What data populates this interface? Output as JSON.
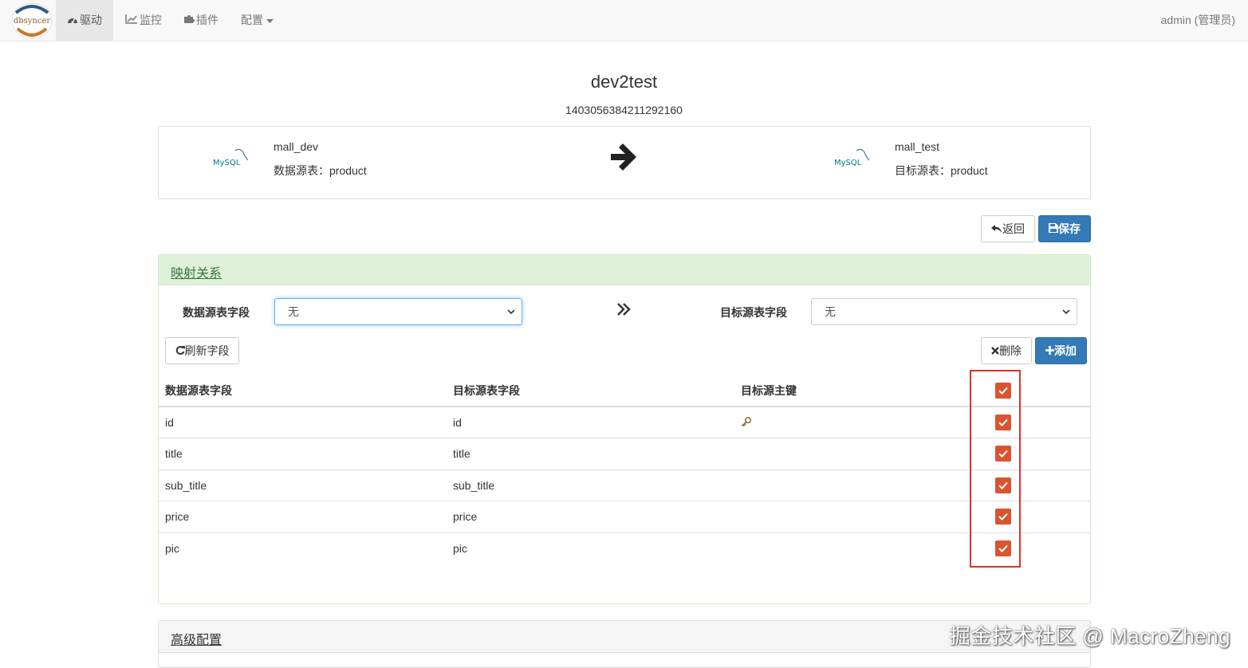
{
  "nav": {
    "brand": "dbsyncer",
    "items": [
      {
        "label": "驱动",
        "icon": "dashboard-icon",
        "active": true
      },
      {
        "label": "监控",
        "icon": "line-chart-icon",
        "active": false
      },
      {
        "label": "插件",
        "icon": "puzzle-icon",
        "active": false
      },
      {
        "label": "配置",
        "icon": "caret-down-icon",
        "active": false
      }
    ],
    "user": "admin (管理员)"
  },
  "task": {
    "name": "dev2test",
    "id": "1403056384211292160"
  },
  "source": {
    "logo": "MySQL",
    "connector": "mall_dev",
    "table_label": "数据源表：product"
  },
  "target": {
    "logo": "MySQL",
    "connector": "mall_test",
    "table_label": "目标源表：product"
  },
  "actions": {
    "back": "返回",
    "save": "保存"
  },
  "mapping": {
    "title": "映射关系",
    "source_field_label": "数据源表字段",
    "target_field_label": "目标源表字段",
    "source_select_value": "无",
    "target_select_value": "无",
    "refresh_button": "刷新字段",
    "delete_button": "删除",
    "add_button": "添加",
    "columns": [
      "数据源表字段",
      "目标源表字段",
      "目标源主键"
    ],
    "rows": [
      {
        "source": "id",
        "target": "id",
        "pk": true,
        "checked": true
      },
      {
        "source": "title",
        "target": "title",
        "pk": false,
        "checked": true
      },
      {
        "source": "sub_title",
        "target": "sub_title",
        "pk": false,
        "checked": true
      },
      {
        "source": "price",
        "target": "price",
        "pk": false,
        "checked": true
      },
      {
        "source": "pic",
        "target": "pic",
        "pk": false,
        "checked": true
      }
    ],
    "header_checked": true
  },
  "advanced": {
    "title": "高级配置"
  },
  "watermark": "掘金技术社区 @ MacroZheng",
  "colors": {
    "primary": "#337ab7",
    "panel_success": "#dff0d8",
    "checkbox": "#d9542f",
    "highlight_box": "#d9342b"
  }
}
